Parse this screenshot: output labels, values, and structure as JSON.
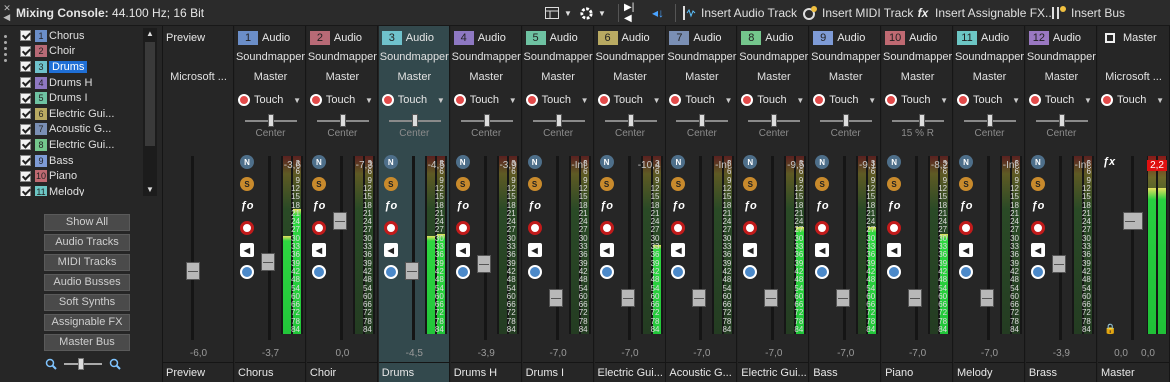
{
  "window": {
    "title": "Mixing Console:",
    "subtitle": "44.100 Hz; 16 Bit"
  },
  "toolbar": {
    "insert_audio": "Insert Audio Track",
    "insert_midi": "Insert MIDI Track",
    "insert_fx": "Insert Assignable FX...",
    "insert_bus": "Insert Bus"
  },
  "tracklist": [
    {
      "num": "1",
      "label": "Chorus",
      "color": "#6b8ec8"
    },
    {
      "num": "2",
      "label": "Choir",
      "color": "#b86a76"
    },
    {
      "num": "3",
      "label": "Drums",
      "color": "#6fc2cc"
    },
    {
      "num": "4",
      "label": "Drums H",
      "color": "#8e78c2"
    },
    {
      "num": "5",
      "label": "Drums I",
      "color": "#6ec2a2"
    },
    {
      "num": "6",
      "label": "Electric Gui...",
      "color": "#b9aa62"
    },
    {
      "num": "7",
      "label": "Acoustic G...",
      "color": "#7a8fb4"
    },
    {
      "num": "8",
      "label": "Electric Gui...",
      "color": "#74c68c"
    },
    {
      "num": "9",
      "label": "Bass",
      "color": "#7e9bd6"
    },
    {
      "num": "10",
      "label": "Piano",
      "color": "#bf6a72"
    },
    {
      "num": "11",
      "label": "Melody",
      "color": "#6cc6c4"
    }
  ],
  "filters": [
    "Show All",
    "Audio Tracks",
    "MIDI Tracks",
    "Audio Busses",
    "Soft Synths",
    "Assignable FX",
    "Master Bus"
  ],
  "preview": {
    "header": "Preview",
    "device": "Microsoft ...",
    "fader_value": "-6,0",
    "name": "Preview"
  },
  "master": {
    "header": "Master",
    "device": "Microsoft ...",
    "automation": "Touch",
    "peak_l": "2,2",
    "fader_l": "0,0",
    "fader_r": "0,0",
    "name": "Master"
  },
  "strips": [
    {
      "num": "1",
      "type": "Audio",
      "input": "Soundmapper",
      "output": "Master",
      "automation": "Touch",
      "pan": "Center",
      "peak": "-3,6",
      "fader": "-3,7",
      "name": "Chorus",
      "color": "#6b8ec8",
      "level": 0.55,
      "level_r": 0.7
    },
    {
      "num": "2",
      "type": "Audio",
      "input": "Soundmapper",
      "output": "Master",
      "automation": "Touch",
      "pan": "Center",
      "peak": "-7,3",
      "fader": "0,0",
      "name": "Choir",
      "color": "#b86a76",
      "level": 0,
      "level_r": 0
    },
    {
      "num": "3",
      "type": "Audio",
      "input": "Soundmapper",
      "output": "Master",
      "automation": "Touch",
      "pan": "Center",
      "peak": "-4,5",
      "fader": "-4,5",
      "name": "Drums",
      "color": "#6fc2cc",
      "level": 0.55,
      "level_r": 0.56
    },
    {
      "num": "4",
      "type": "Audio",
      "input": "Soundmapper",
      "output": "Master",
      "automation": "Touch",
      "pan": "Center",
      "peak": "-3,9",
      "fader": "-3,9",
      "name": "Drums H",
      "color": "#8e78c2",
      "level": 0,
      "level_r": 0
    },
    {
      "num": "5",
      "type": "Audio",
      "input": "Soundmapper",
      "output": "Master",
      "automation": "Touch",
      "pan": "Center",
      "peak": "-Inf.",
      "fader": "-7,0",
      "name": "Drums I",
      "color": "#6ec2a2",
      "level": 0,
      "level_r": 0
    },
    {
      "num": "6",
      "type": "Audio",
      "input": "Soundmapper",
      "output": "Master",
      "automation": "Touch",
      "pan": "Center",
      "peak": "-10,4",
      "fader": "-7,0",
      "name": "Electric Gui...",
      "color": "#b9aa62",
      "level": 0,
      "level_r": 0.5
    },
    {
      "num": "7",
      "type": "Audio",
      "input": "Soundmapper",
      "output": "Master",
      "automation": "Touch",
      "pan": "Center",
      "peak": "-Inf.",
      "fader": "-7,0",
      "name": "Acoustic G...",
      "color": "#7a8fb4",
      "level": 0,
      "level_r": 0
    },
    {
      "num": "8",
      "type": "Audio",
      "input": "Soundmapper",
      "output": "Master",
      "automation": "Touch",
      "pan": "Center",
      "peak": "-9,5",
      "fader": "-7,0",
      "name": "Electric Gui...",
      "color": "#74c68c",
      "level": 0,
      "level_r": 0.6
    },
    {
      "num": "9",
      "type": "Audio",
      "input": "Soundmapper",
      "output": "Master",
      "automation": "Touch",
      "pan": "Center",
      "peak": "-9,1",
      "fader": "-7,0",
      "name": "Bass",
      "color": "#7e9bd6",
      "level": 0,
      "level_r": 0.6
    },
    {
      "num": "10",
      "type": "Audio",
      "input": "Soundmapper",
      "output": "Master",
      "automation": "Touch",
      "pan": "15 % R",
      "peak": "-8,2",
      "fader": "-7,0",
      "name": "Piano",
      "color": "#bf6a72",
      "level": 0,
      "level_r": 0.56
    },
    {
      "num": "11",
      "type": "Audio",
      "input": "Soundmapper",
      "output": "Master",
      "automation": "Touch",
      "pan": "Center",
      "peak": "-Inf.",
      "fader": "-7,0",
      "name": "Melody",
      "color": "#6cc6c4",
      "level": 0,
      "level_r": 0
    },
    {
      "num": "12",
      "type": "Audio",
      "input": "Soundmapper",
      "output": "Master",
      "automation": "Touch",
      "pan": "Center",
      "peak": "-Inf.",
      "fader": "-3,9",
      "name": "Brass",
      "color": "#9a78c2",
      "level": 0,
      "level_r": 0
    }
  ],
  "meter_scale": [
    "3",
    "6",
    "9",
    "12",
    "15",
    "18",
    "21",
    "24",
    "27",
    "30",
    "33",
    "36",
    "39",
    "42",
    "48",
    "54",
    "60",
    "66",
    "72",
    "78",
    "84"
  ],
  "icons": {
    "mute": "mute-icon",
    "solo": "solo-icon",
    "fx": "fx-icon",
    "rec": "record-icon",
    "monitor": "monitor-icon",
    "phase": "phase-icon"
  }
}
